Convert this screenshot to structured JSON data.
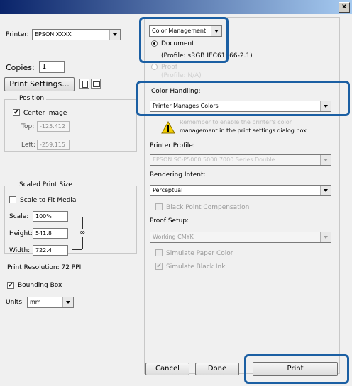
{
  "window": {
    "close_label": "x"
  },
  "left": {
    "printer_label": "Printer:",
    "printer_value": "EPSON XXXX",
    "copies_label": "Copies:",
    "copies_value": "1",
    "print_settings_label": "Print Settings...",
    "position": {
      "title": "Position",
      "center_image_label": "Center Image",
      "center_image_checked": "✔",
      "top_label": "Top:",
      "top_value": "-125.412",
      "left_label": "Left:",
      "left_value": "-259.115"
    },
    "scaled": {
      "title": "Scaled Print Size",
      "scale_to_fit_label": "Scale to Fit Media",
      "scale_label": "Scale:",
      "scale_value": "100%",
      "height_label": "Height:",
      "height_value": "541.8",
      "width_label": "Width:",
      "width_value": "722.4",
      "resolution_text": "Print Resolution: 72 PPI"
    },
    "bounding_box_label": "Bounding Box",
    "bounding_box_checked": "✔",
    "units_label": "Units:",
    "units_value": "mm"
  },
  "right": {
    "color_management_value": "Color Management",
    "document_label": "Document",
    "profile_text": "(Profile: sRGB IEC61966-2.1)",
    "proof_label": "Proof",
    "proof_profile_text": "(Profile: N/A)",
    "color_handling_label": "Color Handling:",
    "color_handling_value": "Printer Manages Colors",
    "warning_line1": "Remember to enable the printer's color",
    "warning_line2": "management in the print settings dialog box.",
    "printer_profile_label": "Printer Profile:",
    "printer_profile_value": "EPSON SC-P5000 5000 7000 Series Double",
    "rendering_intent_label": "Rendering Intent:",
    "rendering_intent_value": "Perceptual",
    "black_point_label": "Black Point Compensation",
    "proof_setup_label": "Proof Setup:",
    "proof_setup_value": "Working CMYK",
    "simulate_paper_label": "Simulate Paper Color",
    "simulate_black_label": "Simulate Black Ink",
    "simulate_black_checked": "✔"
  },
  "footer": {
    "cancel_label": "Cancel",
    "done_label": "Done",
    "print_label": "Print"
  },
  "colors": {
    "highlight": "#1b5fa3",
    "title_gradient_start": "#0a246a"
  }
}
